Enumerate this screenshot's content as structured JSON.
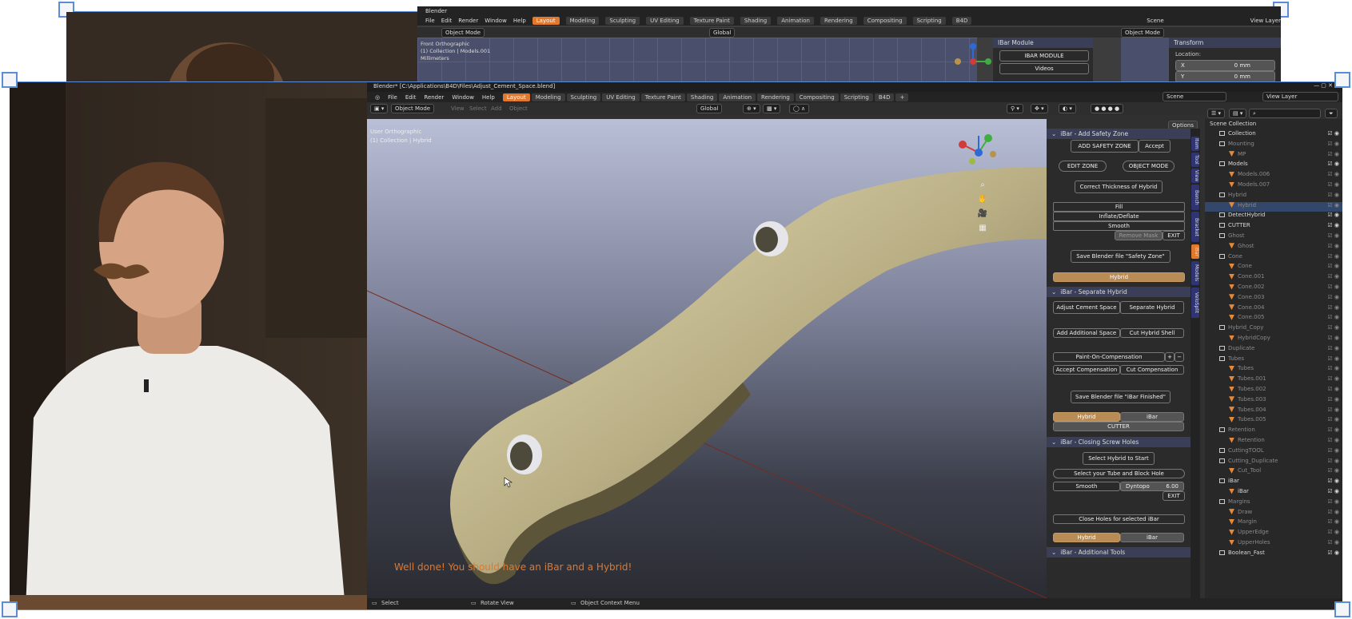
{
  "colors": {
    "accent": "#e0782d",
    "selection": "#5b8dd6",
    "panel_header": "#3a3f57",
    "model": "#c9bf95"
  },
  "back_window": {
    "title": "Blender",
    "menu": [
      "File",
      "Edit",
      "Render",
      "Window",
      "Help"
    ],
    "workspaces": [
      "Layout",
      "Modeling",
      "Sculpting",
      "UV Editing",
      "Texture Paint",
      "Shading",
      "Animation",
      "Rendering",
      "Compositing",
      "Scripting",
      "B4D"
    ],
    "mode": "Object Mode",
    "orientation": "Global",
    "viewport_info": [
      "Front Orthographic",
      "(1) Collection | Models.001",
      "Millimeters"
    ],
    "scene": "Scene",
    "view_layer": "View Layer",
    "ibar_module_title": "IBar Module",
    "ibar_module_button": "IBAR MODULE",
    "videos_button": "Videos",
    "transform_title": "Transform",
    "location_label": "Location:",
    "x_label": "X",
    "x_value": "0 mm",
    "y_label": "Y",
    "y_value": "0 mm"
  },
  "window": {
    "title": "Blender* [C:\\Applications\\B4D\\Files\\Adjust_Cement_Space.blend]",
    "menu": [
      "File",
      "Edit",
      "Render",
      "Window",
      "Help"
    ],
    "workspaces": [
      "Layout",
      "Modeling",
      "Sculpting",
      "UV Editing",
      "Texture Paint",
      "Shading",
      "Animation",
      "Rendering",
      "Compositing",
      "Scripting",
      "B4D"
    ],
    "mode": "Object Mode",
    "orientation": "Global",
    "header_menus": [
      "View",
      "Select",
      "Add",
      "Object"
    ],
    "scene": "Scene",
    "view_layer": "View Layer",
    "options": "Options"
  },
  "viewport": {
    "info_line1": "User Orthographic",
    "info_line2": "(1) Collection | Hybrid",
    "caption": "Well done! You should have an iBar and a Hybrid!",
    "gizmo_axes": [
      "X",
      "Y",
      "Z"
    ]
  },
  "safety_zone": {
    "title": "iBar - Add Safety Zone",
    "add_safety_zone": "ADD SAFETY ZONE",
    "accept": "Accept",
    "edit_zone": "EDIT ZONE",
    "object_mode": "OBJECT MODE",
    "correct_thickness": "Correct Thickness of Hybrid",
    "fill": "Fill",
    "inflate_deflate": "Inflate/Deflate",
    "smooth": "Smooth",
    "remove_mask": "Remove Mask",
    "exit": "EXIT",
    "save_safety": "Save Blender file \"Safety Zone\"",
    "hybrid": "Hybrid"
  },
  "separate": {
    "title": "iBar - Separate Hybrid",
    "adjust_cement": "Adjust Cement Space",
    "separate_hybrid": "Separate Hybrid",
    "add_space": "Add Additional Space",
    "cut_shell": "Cut Hybrid Shell",
    "paint_comp": "Paint-On-Compensation",
    "plus": "+",
    "minus": "−",
    "accept_comp": "Accept Compensation",
    "cut_comp": "Cut Compensation",
    "save_finished": "Save Blender file \"iBar Finished\"",
    "hybrid": "Hybrid",
    "ibar": "iBar",
    "cutter": "CUTTER"
  },
  "screw_holes": {
    "title": "iBar - Closing Screw Holes",
    "select_hybrid": "Select Hybrid to Start",
    "select_tube": "Select your Tube and Block Hole",
    "smooth": "Smooth",
    "dyntopo": "Dyntopo",
    "dyntopo_value": "6.00",
    "exit": "EXIT",
    "close_holes": "Close Holes for selected iBar",
    "hybrid": "Hybrid",
    "ibar": "iBar"
  },
  "additional": {
    "title": "iBar - Additional Tools"
  },
  "side_tabs": [
    "Item",
    "Tool",
    "View",
    "Bench",
    "Bracket",
    "iBar",
    "Models",
    "VeloSplit"
  ],
  "outliner": {
    "root": "Scene Collection",
    "rows": [
      {
        "label": "Collection",
        "type": "bx",
        "dim": false,
        "sel": false
      },
      {
        "label": "Mounting",
        "type": "bx",
        "dim": true,
        "sel": false
      },
      {
        "label": "MP",
        "type": "ic",
        "dim": true,
        "sel": false
      },
      {
        "label": "Models",
        "type": "bx",
        "dim": false,
        "sel": false
      },
      {
        "label": "Models.006",
        "type": "ic",
        "dim": true,
        "sel": false
      },
      {
        "label": "Models.007",
        "type": "ic",
        "dim": true,
        "sel": false
      },
      {
        "label": "Hybrid",
        "type": "bx",
        "dim": true,
        "sel": false
      },
      {
        "label": "Hybrid",
        "type": "ic",
        "dim": true,
        "sel": true
      },
      {
        "label": "DetectHybrid",
        "type": "bx",
        "dim": false,
        "sel": false
      },
      {
        "label": "CUTTER",
        "type": "bx",
        "dim": false,
        "sel": false
      },
      {
        "label": "Ghost",
        "type": "bx",
        "dim": true,
        "sel": false
      },
      {
        "label": "Ghost",
        "type": "ic",
        "dim": true,
        "sel": false
      },
      {
        "label": "Cone",
        "type": "bx",
        "dim": true,
        "sel": false
      },
      {
        "label": "Cone",
        "type": "ic",
        "dim": true,
        "sel": false
      },
      {
        "label": "Cone.001",
        "type": "ic",
        "dim": true,
        "sel": false
      },
      {
        "label": "Cone.002",
        "type": "ic",
        "dim": true,
        "sel": false
      },
      {
        "label": "Cone.003",
        "type": "ic",
        "dim": true,
        "sel": false
      },
      {
        "label": "Cone.004",
        "type": "ic",
        "dim": true,
        "sel": false
      },
      {
        "label": "Cone.005",
        "type": "ic",
        "dim": true,
        "sel": false
      },
      {
        "label": "Hybrid_Copy",
        "type": "bx",
        "dim": true,
        "sel": false
      },
      {
        "label": "HybridCopy",
        "type": "ic",
        "dim": true,
        "sel": false
      },
      {
        "label": "Duplicate",
        "type": "bx",
        "dim": true,
        "sel": false
      },
      {
        "label": "Tubes",
        "type": "bx",
        "dim": true,
        "sel": false
      },
      {
        "label": "Tubes",
        "type": "ic",
        "dim": true,
        "sel": false
      },
      {
        "label": "Tubes.001",
        "type": "ic",
        "dim": true,
        "sel": false
      },
      {
        "label": "Tubes.002",
        "type": "ic",
        "dim": true,
        "sel": false
      },
      {
        "label": "Tubes.003",
        "type": "ic",
        "dim": true,
        "sel": false
      },
      {
        "label": "Tubes.004",
        "type": "ic",
        "dim": true,
        "sel": false
      },
      {
        "label": "Tubes.005",
        "type": "ic",
        "dim": true,
        "sel": false
      },
      {
        "label": "Retention",
        "type": "bx",
        "dim": true,
        "sel": false
      },
      {
        "label": "Retention",
        "type": "ic",
        "dim": true,
        "sel": false
      },
      {
        "label": "CuttingTOOL",
        "type": "bx",
        "dim": true,
        "sel": false
      },
      {
        "label": "Cutting_Duplicate",
        "type": "bx",
        "dim": true,
        "sel": false
      },
      {
        "label": "Cut_Tool",
        "type": "ic",
        "dim": true,
        "sel": false
      },
      {
        "label": "iBar",
        "type": "bx",
        "dim": false,
        "sel": false
      },
      {
        "label": "iBar",
        "type": "ic",
        "dim": false,
        "sel": false
      },
      {
        "label": "Margins",
        "type": "bx",
        "dim": true,
        "sel": false
      },
      {
        "label": "Draw",
        "type": "ic",
        "dim": true,
        "sel": false
      },
      {
        "label": "Margin",
        "type": "ic",
        "dim": true,
        "sel": false
      },
      {
        "label": "UpperEdge",
        "type": "ic",
        "dim": true,
        "sel": false
      },
      {
        "label": "UpperHoles",
        "type": "ic",
        "dim": true,
        "sel": false
      },
      {
        "label": "Boolean_Fast",
        "type": "bx",
        "dim": false,
        "sel": false
      }
    ]
  },
  "statusbar": {
    "select": "Select",
    "rotate": "Rotate View",
    "context": "Object Context Menu"
  }
}
